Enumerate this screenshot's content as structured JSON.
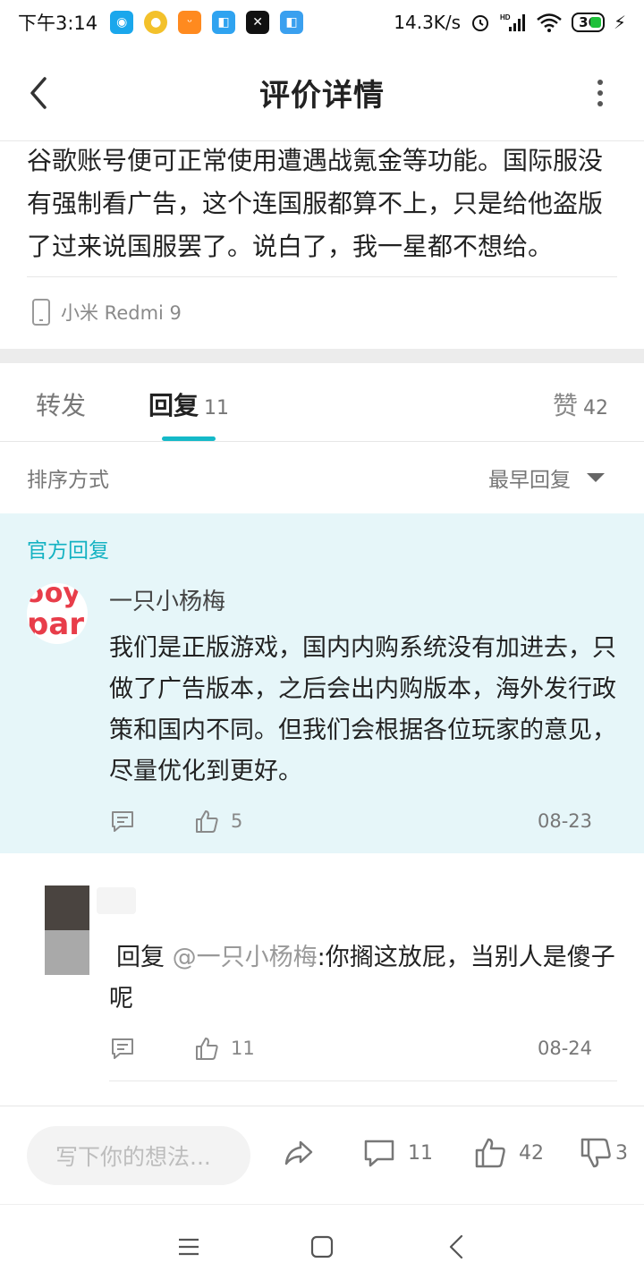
{
  "status_bar": {
    "time": "下午3:14",
    "network_speed": "14.3K/s",
    "signal_label": "HD",
    "battery": "36"
  },
  "header": {
    "title": "评价详情",
    "back_icon": "chevron-left-icon",
    "more_icon": "vertical-dots-icon"
  },
  "review": {
    "body": "谷歌账号便可正常使用遭遇战氪金等功能。国际服没有强制看广告，这个连国服都算不上，只是给他盗版了过来说国服罢了。说白了，我一星都不想给。",
    "device": "小米 Redmi 9"
  },
  "tabs": {
    "forward_label": "转发",
    "reply_label": "回复",
    "reply_count": "11",
    "likes_label": "赞",
    "likes_count": "42"
  },
  "sort": {
    "label": "排序方式",
    "value": "最早回复"
  },
  "official_reply": {
    "section_label": "官方回复",
    "author": "一只小杨梅",
    "content": "我们是正版游戏，国内内购系统没有加进去，只做了广告版本，之后会出内购版本，海外发行政策和国内不同。但我们会根据各位玩家的意见，尽量优化到更好。",
    "like_count": "5",
    "date": "08-23"
  },
  "user_reply": {
    "prefix": "回复 ",
    "mention": "@一只小杨梅",
    "content": ":你搁这放屁，当别人是傻子呢",
    "like_count": "11",
    "date": "08-24"
  },
  "bottom_bar": {
    "input_placeholder": "写下你的想法...",
    "comment_count": "11",
    "like_count": "42",
    "dislike_count": "3"
  },
  "colors": {
    "accent": "#14b9c8",
    "official_bg": "#e6f6f9",
    "avatar_red": "#e83d4a"
  }
}
